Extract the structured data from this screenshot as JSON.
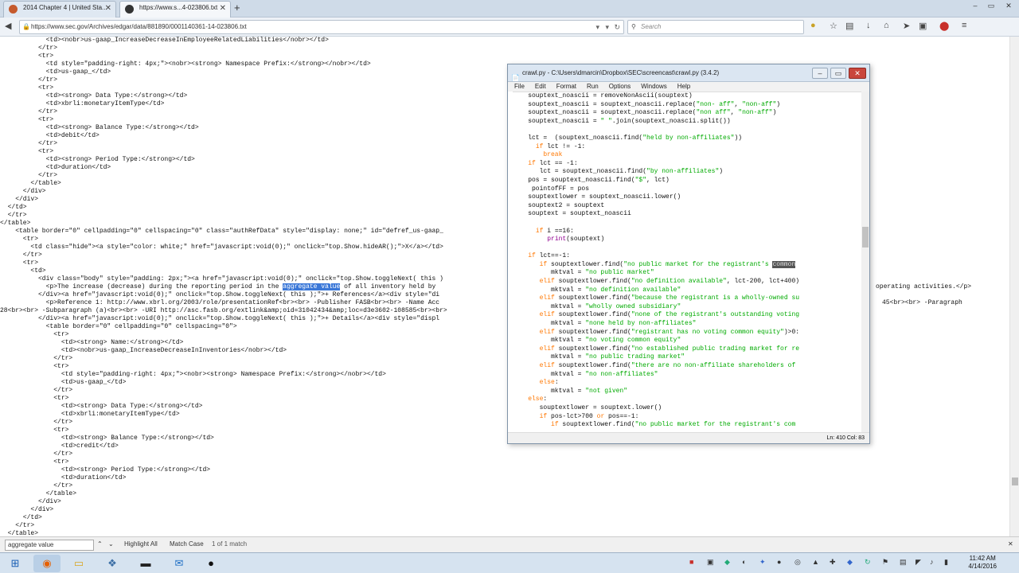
{
  "browser": {
    "tabs": [
      {
        "label": "2014 Chapter 4 | United Sta...",
        "active": false
      },
      {
        "label": "https://www.s...4-023806.txt",
        "active": true
      }
    ],
    "url": "https://www.sec.gov/Archives/edgar/data/881890/0001140361-14-023806.txt",
    "search_placeholder": "Search"
  },
  "page": {
    "lines": [
      "            <td><nobr>us-gaap_IncreaseDecreaseInEmployeeRelatedLiabilities</nobr></td>",
      "          </tr>",
      "          <tr>",
      "            <td style=\"padding-right: 4px;\"><nobr><strong> Namespace Prefix:</strong></nobr></td>",
      "            <td>us-gaap_</td>",
      "          </tr>",
      "          <tr>",
      "            <td><strong> Data Type:</strong></td>",
      "            <td>xbrli:monetaryItemType</td>",
      "          </tr>",
      "          <tr>",
      "            <td><strong> Balance Type:</strong></td>",
      "            <td>debit</td>",
      "          </tr>",
      "          <tr>",
      "            <td><strong> Period Type:</strong></td>",
      "            <td>duration</td>",
      "          </tr>",
      "        </table>",
      "      </div>",
      "    </div>",
      "  </td>",
      "  </tr>",
      "</table>",
      "    <table border=\"0\" cellpadding=\"0\" cellspacing=\"0\" class=\"authRefData\" style=\"display: none;\" id=\"defref_us-gaap_",
      "      <tr>",
      "        <td class=\"hide\"><a style=\"color: white;\" href=\"javascript:void(0);\" onclick=\"top.Show.hideAR();\">X</a></td>",
      "      </tr>",
      "      <tr>",
      "        <td>",
      "          <div class=\"body\" style=\"padding: 2px;\"><a href=\"javascript:void(0);\" onclick=\"top.Show.toggleNext( this )",
      "            <p>The increase (decrease) during the reporting period in the ",
      "          </div><a href=\"javascript:void(0);\" onclick=\"top.Show.toggleNext( this );\">+ References</a><div style=\"di",
      "            <p>Reference 1: http://www.xbrl.org/2003/role/presentationRef<br><br> -Publisher FASB<br><br> -Name Acc",
      "28<br><br> -Subparagraph (a)<br><br> -URI http://asc.fasb.org/extlink&amp;oid=31042434&amp;loc=d3e3602-108585<br><br>",
      "          </div><a href=\"javascript:void(0);\" onclick=\"top.Show.toggleNext( this );\">+ Details</a><div style=\"displ",
      "            <table border=\"0\" cellpadding=\"0\" cellspacing=\"0\">",
      "              <tr>",
      "                <td><strong> Name:</strong></td>",
      "                <td><nobr>us-gaap_IncreaseDecreaseInInventories</nobr></td>",
      "              </tr>",
      "              <tr>",
      "                <td style=\"padding-right: 4px;\"><nobr><strong> Namespace Prefix:</strong></nobr></td>",
      "                <td>us-gaap_</td>",
      "              </tr>",
      "              <tr>",
      "                <td><strong> Data Type:</strong></td>",
      "                <td>xbrli:monetaryItemType</td>",
      "              </tr>",
      "              <tr>",
      "                <td><strong> Balance Type:</strong></td>",
      "                <td>credit</td>",
      "              </tr>",
      "              <tr>",
      "                <td><strong> Period Type:</strong></td>",
      "                <td>duration</td>",
      "              </tr>",
      "            </table>",
      "          </div>",
      "        </div>",
      "      </td>",
      "    </tr>",
      "  </table>"
    ],
    "highlight": {
      "before": "            <p>The increase (decrease) during the reporting period in the ",
      "text": "aggregate value",
      "after": " of all inventory held by"
    },
    "right_fragments": {
      "operating": "operating activities.</p>",
      "paragraph": "45<br><br> -Paragraph"
    }
  },
  "findbar": {
    "query": "aggregate value",
    "highlight_all": "Highlight All",
    "match_case": "Match Case",
    "result": "1 of 1 match"
  },
  "idle": {
    "title": "crawl.py - C:\\Users\\dmarcin\\Dropbox\\SEC\\screencast\\crawl.py (3.4.2)",
    "menu": [
      "File",
      "Edit",
      "Format",
      "Run",
      "Options",
      "Windows",
      "Help"
    ],
    "status": "Ln: 410  Col: 83"
  },
  "taskbar": {
    "time": "11:42 AM",
    "date": "4/14/2016"
  },
  "colors": {
    "highlight": "#3b78d8",
    "idle_keyword": "#ff7700",
    "idle_string": "#00aa00",
    "idle_builtin": "#900090"
  }
}
